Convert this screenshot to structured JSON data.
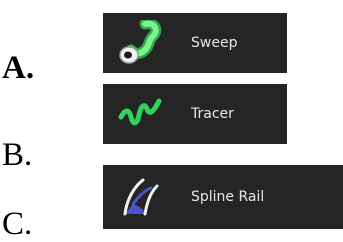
{
  "options": {
    "a": "A.",
    "b": "B.",
    "c": "C."
  },
  "tools": [
    {
      "label": "Sweep",
      "icon": "sweep-icon",
      "color": "#52d46b"
    },
    {
      "label": "Tracer",
      "icon": "tracer-icon",
      "color": "#2fd45c"
    },
    {
      "label": "Spline Rail",
      "icon": "spline-rail-icon",
      "color": "#4a55c8"
    }
  ],
  "colors": {
    "panel_background": "#1b1b1b",
    "label_text": "#e6e6e6",
    "page_background": "#ffffff"
  }
}
